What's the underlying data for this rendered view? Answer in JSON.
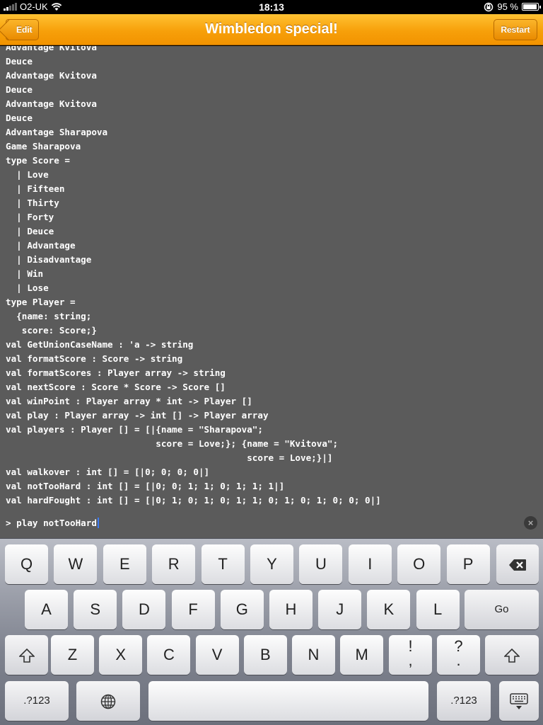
{
  "status_bar": {
    "carrier": "O2-UK",
    "time": "18:13",
    "battery": "95 %",
    "battery_level": 0.95
  },
  "nav": {
    "title": "Wimbledon special!",
    "left_button": "Edit",
    "right_button": "Restart"
  },
  "console": {
    "output_lines": [
      "Advantage Kvitova",
      "Deuce",
      "Advantage Kvitova",
      "Deuce",
      "Advantage Kvitova",
      "Deuce",
      "Advantage Sharapova",
      "Game Sharapova",
      "type Score =",
      "  | Love",
      "  | Fifteen",
      "  | Thirty",
      "  | Forty",
      "  | Deuce",
      "  | Advantage",
      "  | Disadvantage",
      "  | Win",
      "  | Lose",
      "type Player =",
      "  {name: string;",
      "   score: Score;}",
      "val GetUnionCaseName : 'a -> string",
      "val formatScore : Score -> string",
      "val formatScores : Player array -> string",
      "val nextScore : Score * Score -> Score []",
      "val winPoint : Player array * int -> Player []",
      "val play : Player array -> int [] -> Player array",
      "val players : Player [] = [|{name = \"Sharapova\";",
      "                            score = Love;}; {name = \"Kvitova\";",
      "                                             score = Love;}|]",
      "val walkover : int [] = [|0; 0; 0; 0|]",
      "val notTooHard : int [] = [|0; 0; 1; 1; 0; 1; 1; 1|]",
      "val hardFought : int [] = [|0; 1; 0; 1; 0; 1; 1; 0; 1; 0; 1; 0; 0; 0|]"
    ],
    "prompt": "> ",
    "input": "play notTooHard"
  },
  "keyboard": {
    "row1": [
      "Q",
      "W",
      "E",
      "R",
      "T",
      "Y",
      "U",
      "I",
      "O",
      "P"
    ],
    "row2": [
      "A",
      "S",
      "D",
      "F",
      "G",
      "H",
      "J",
      "K",
      "L"
    ],
    "go": "Go",
    "row3": [
      "Z",
      "X",
      "C",
      "V",
      "B",
      "N",
      "M"
    ],
    "punct1": [
      "!",
      ","
    ],
    "punct2": [
      "?",
      "."
    ],
    "numbers": ".?123"
  }
}
